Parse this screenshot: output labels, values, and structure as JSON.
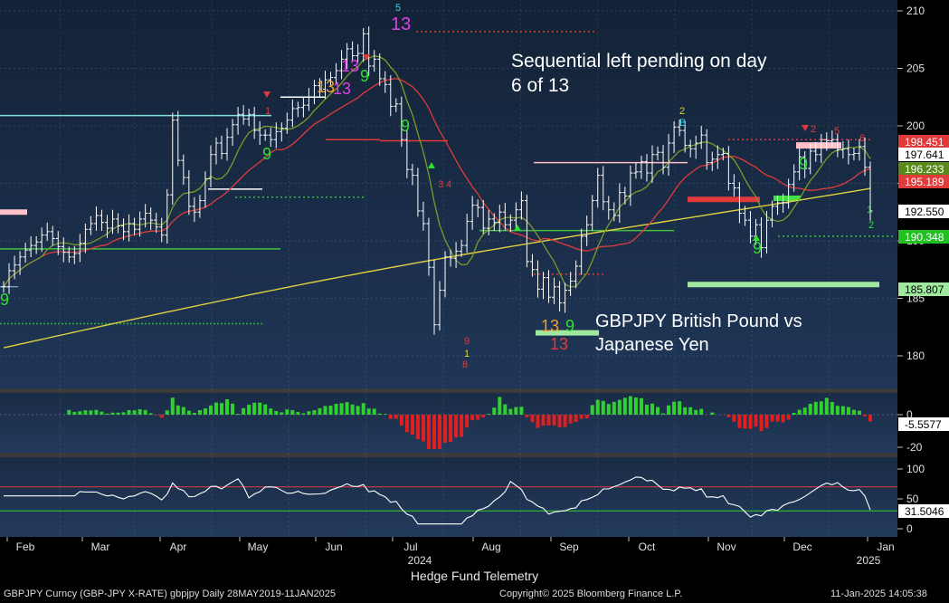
{
  "chart_data": {
    "type": "candlestick",
    "series_name": "GBPJPY Curncy",
    "annotation_top": [
      "Sequential left pending on day",
      "6 of 13"
    ],
    "annotation_mid": [
      "GBPJPY British Pound vs",
      "Japanese Yen"
    ],
    "ylim": [
      177,
      211
    ],
    "yticks": [
      180,
      185,
      190,
      195,
      200,
      205,
      210
    ],
    "last_value_labels": [
      {
        "value": "198.451",
        "color": "#e23a3a"
      },
      {
        "value": "197.641",
        "color": "#ffffff"
      },
      {
        "value": "196.233",
        "color": "#5a8a1a"
      },
      {
        "value": "195.189",
        "color": "#e23a3a"
      },
      {
        "value": "192.550",
        "color": "#ffffff"
      },
      {
        "value": "190.348",
        "color": "#20c020"
      },
      {
        "value": "185.807",
        "color": "#a0e8a0"
      }
    ],
    "months": [
      "Feb",
      "Mar",
      "Apr",
      "May",
      "Jun",
      "Jul",
      "Aug",
      "Sep",
      "Oct",
      "Nov",
      "Dec",
      "Jan"
    ],
    "year_labels": [
      "2024",
      "2025"
    ],
    "closes": [
      186.0,
      187.4,
      187.9,
      188.6,
      189.2,
      189.6,
      189.9,
      190.5,
      190.8,
      190.2,
      189.5,
      189.0,
      188.6,
      188.9,
      189.8,
      191.0,
      191.5,
      192.2,
      191.6,
      191.1,
      191.9,
      191.3,
      190.8,
      191.5,
      191.0,
      191.9,
      192.4,
      191.8,
      191.2,
      190.5,
      194.0,
      200.5,
      197.0,
      195.5,
      193.0,
      192.5,
      193.5,
      195.4,
      197.5,
      198.5,
      197.6,
      199.0,
      200.1,
      201.0,
      200.6,
      201.0,
      199.6,
      199.2,
      199.2,
      198.8,
      199.5,
      199.8,
      200.5,
      201.5,
      201.6,
      201.8,
      202.5,
      203.5,
      203.2,
      204.0,
      204.2,
      204.8,
      205.8,
      206.7,
      206.1,
      206.3,
      208.0,
      205.2,
      205.8,
      204.1,
      203.6,
      201.7,
      201.9,
      198.8,
      196.2,
      195.7,
      192.6,
      191.5,
      187.7,
      182.7,
      185.7,
      188.6,
      188.5,
      189.1,
      189.6,
      191.7,
      193.1,
      192.9,
      191.1,
      191.9,
      191.6,
      192.5,
      191.4,
      191.8,
      192.7,
      193.5,
      188.2,
      187.5,
      185.8,
      186.8,
      185.1,
      186.0,
      184.6,
      185.7,
      186.5,
      187.8,
      190.4,
      191.4,
      193.5,
      195.7,
      193.4,
      192.7,
      192.2,
      194.2,
      193.9,
      195.9,
      196.0,
      196.9,
      195.9,
      197.5,
      197.7,
      196.4,
      198.5,
      199.9,
      199.6,
      198.3,
      198.0,
      198.5,
      199.2,
      196.8,
      197.1,
      197.5,
      197.6,
      195.0,
      194.6,
      192.4,
      191.8,
      190.4,
      191.4,
      189.4,
      191.8,
      193.0,
      193.3,
      193.3,
      194.9,
      196.0,
      197.3,
      196.3,
      197.8,
      197.5,
      198.8,
      198.7,
      198.8,
      197.9,
      198.0,
      197.5,
      197.6,
      198.2,
      196.4,
      192.6
    ],
    "indicator_1": {
      "last_value": "-5.5577",
      "yticks": [
        0,
        -20
      ]
    },
    "indicator_2": {
      "last_value": "31.5046",
      "yticks": [
        100,
        50,
        0
      ],
      "upper": 70,
      "lower": 30
    }
  },
  "footer": {
    "left": "GBPJPY Curncy (GBP-JPY X-RATE) gbpjpy  Daily 28MAY2019-11JAN2025",
    "center_title": "Hedge Fund Telemetry",
    "copyright": "Copyright© 2025 Bloomberg Finance L.P.",
    "timestamp": "11-Jan-2025 14:05:38"
  }
}
